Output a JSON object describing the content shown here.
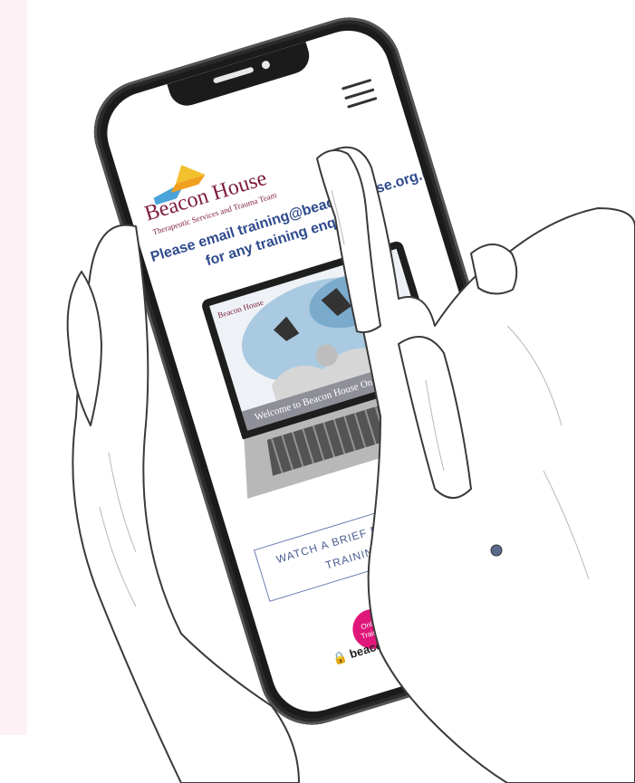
{
  "logo": {
    "name": "Beacon House",
    "tagline": "Therapeutic Services and Trauma Team"
  },
  "email_message": {
    "line1": "Please email training@beaconhouse.org.uk",
    "line2": "for any training enquiries"
  },
  "laptop_screen": {
    "logo": "Beacon House",
    "banner": "Welcome to Beacon House Online Training"
  },
  "watch_button": {
    "line1": "WATCH A BRIEF MOVIE ABOUT OUR",
    "line2": "TRAINING COURSES"
  },
  "badge": {
    "label": "Online Training"
  },
  "url_bar": {
    "text": "beaconhouse.org.uk"
  },
  "colors": {
    "brand": "#7d1c3f",
    "link_blue": "#2f4a8c",
    "badge_pink": "#e0177a",
    "badge_yellow": "#f2d43a",
    "panel_pink": "#fdf1f6"
  },
  "icons": [
    "menu-icon",
    "lock-icon"
  ]
}
